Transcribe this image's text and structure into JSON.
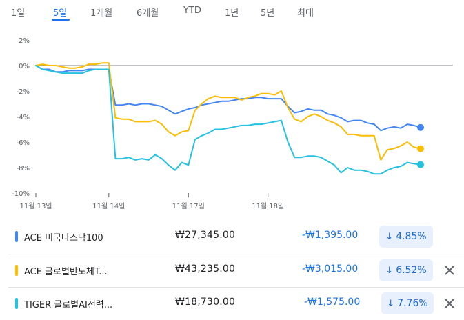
{
  "tabs": [
    {
      "label": "1일",
      "active": false
    },
    {
      "label": "5일",
      "active": true
    },
    {
      "label": "1개월",
      "active": false
    },
    {
      "label": "6개월",
      "active": false
    },
    {
      "label": "YTD",
      "active": false
    },
    {
      "label": "1년",
      "active": false
    },
    {
      "label": "5년",
      "active": false
    },
    {
      "label": "최대",
      "active": false
    }
  ],
  "chart_data": {
    "type": "line",
    "ylim": [
      -10,
      2
    ],
    "yticks": [
      "2%",
      "0%",
      "-2%",
      "-4%",
      "-6%",
      "-8%",
      "-10%"
    ],
    "ytick_values": [
      2,
      0,
      -2,
      -4,
      -6,
      -8,
      -10
    ],
    "xtick_labels": [
      "11월 13일",
      "11월 14일",
      "11월 17일",
      "11월 18일"
    ],
    "xtick_index": [
      0,
      11,
      23,
      35
    ],
    "zero_line": true,
    "series": [
      {
        "name": "ACE 미국나스닥100",
        "color": "#4285f4",
        "values": [
          0,
          -0.3,
          -0.3,
          -0.5,
          -0.5,
          -0.4,
          -0.4,
          -0.4,
          -0.3,
          -0.3,
          -0.3,
          -0.3,
          -3.1,
          -3.1,
          -3.0,
          -3.1,
          -3.0,
          -3.0,
          -3.1,
          -3.2,
          -3.5,
          -3.8,
          -3.6,
          -3.4,
          -3.3,
          -3.1,
          -3.0,
          -2.9,
          -2.8,
          -2.8,
          -2.7,
          -2.6,
          -2.6,
          -2.5,
          -2.5,
          -2.6,
          -2.6,
          -2.6,
          -3.2,
          -3.7,
          -3.6,
          -3.4,
          -3.5,
          -3.5,
          -3.8,
          -3.9,
          -4.1,
          -4.4,
          -4.3,
          -4.3,
          -4.5,
          -4.6,
          -5.1,
          -4.9,
          -4.8,
          -4.9,
          -4.6,
          -4.7,
          -4.85
        ]
      },
      {
        "name": "ACE 글로벌반도체T...",
        "color": "#fbbc04",
        "values": [
          0,
          0.1,
          0,
          0,
          -0.1,
          -0.2,
          -0.2,
          -0.1,
          0.1,
          0.1,
          0.2,
          0.2,
          -4.1,
          -4.2,
          -4.2,
          -4.4,
          -4.4,
          -4.4,
          -4.3,
          -4.6,
          -5.2,
          -5.5,
          -5.2,
          -5.1,
          -3.5,
          -3.0,
          -2.6,
          -2.4,
          -2.5,
          -2.5,
          -2.5,
          -2.7,
          -2.5,
          -2.4,
          -2.2,
          -2.2,
          -2.3,
          -2.0,
          -3.3,
          -4.2,
          -4.4,
          -4.0,
          -3.8,
          -4.0,
          -4.3,
          -4.5,
          -4.8,
          -5.4,
          -5.4,
          -5.5,
          -5.5,
          -5.5,
          -7.4,
          -6.6,
          -6.5,
          -6.3,
          -6.0,
          -6.4,
          -6.52
        ]
      },
      {
        "name": "TIGER 글로벌AI전력...",
        "color": "#24c1e0",
        "values": [
          0,
          -0.3,
          -0.4,
          -0.5,
          -0.6,
          -0.6,
          -0.6,
          -0.6,
          -0.4,
          -0.3,
          -0.3,
          -0.3,
          -7.3,
          -7.3,
          -7.2,
          -7.4,
          -7.3,
          -7.4,
          -7.0,
          -7.3,
          -7.8,
          -8.2,
          -7.6,
          -7.8,
          -5.8,
          -5.5,
          -5.3,
          -5.0,
          -5.0,
          -4.9,
          -4.8,
          -4.7,
          -4.7,
          -4.6,
          -4.6,
          -4.5,
          -4.4,
          -4.3,
          -6.0,
          -7.2,
          -7.2,
          -7.1,
          -7.1,
          -7.2,
          -7.5,
          -7.8,
          -8.4,
          -8.0,
          -8.2,
          -8.2,
          -8.3,
          -8.5,
          -8.5,
          -8.2,
          -8.0,
          -7.9,
          -7.6,
          -7.7,
          -7.76
        ]
      }
    ]
  },
  "rows": [
    {
      "name": "ACE 미국나스닥100",
      "color": "#4285f4",
      "price": "₩27,345.00",
      "change": "-₩1,395.00",
      "pct_arrow": "↓",
      "pct": "4.85%",
      "closable": false
    },
    {
      "name": "ACE 글로벌반도체T...",
      "color": "#fbbc04",
      "price": "₩43,235.00",
      "change": "-₩3,015.00",
      "pct_arrow": "↓",
      "pct": "6.52%",
      "closable": true
    },
    {
      "name": "TIGER 글로벌AI전력...",
      "color": "#24c1e0",
      "price": "₩18,730.00",
      "change": "-₩1,575.00",
      "pct_arrow": "↓",
      "pct": "7.76%",
      "closable": true
    }
  ],
  "icons": {
    "close": "close-icon",
    "down_arrow": "arrow-down-icon"
  }
}
